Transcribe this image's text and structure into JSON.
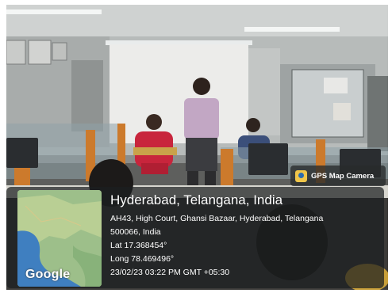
{
  "badge": {
    "label": "GPS Map Camera",
    "icon": "gps-map-camera-icon"
  },
  "map": {
    "brand": "Google"
  },
  "location": {
    "title": "Hyderabad, Telangana, India",
    "address_line1": "AH43, High Court, Ghansi Bazaar, Hyderabad, Telangana",
    "address_line2": "500066, India",
    "latitude": "Lat 17.368454°",
    "longitude": "Long 78.469496°",
    "timestamp": "23/02/23 03:22 PM GMT +05:30"
  },
  "colors": {
    "overlay": "#1c1e20",
    "text": "#ffffff",
    "water": "#3f7fc0",
    "land": "#9dbf8a"
  }
}
